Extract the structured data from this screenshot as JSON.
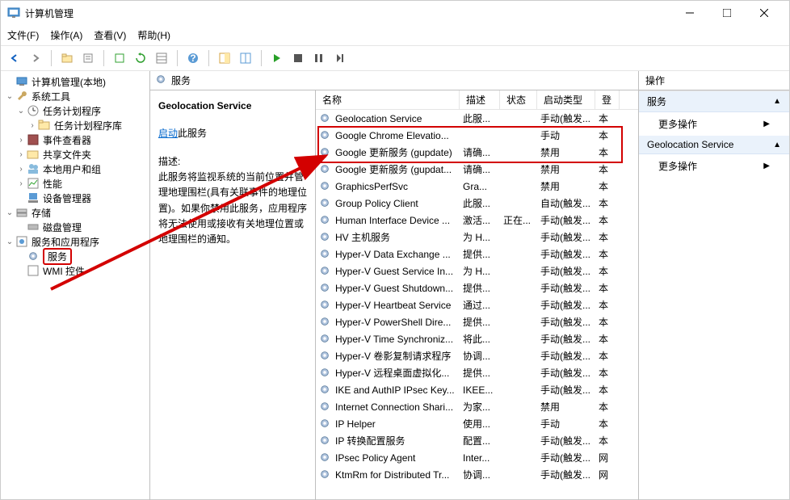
{
  "window": {
    "title": "计算机管理"
  },
  "menubar": [
    "文件(F)",
    "操作(A)",
    "查看(V)",
    "帮助(H)"
  ],
  "tree": {
    "root": "计算机管理(本地)",
    "system_tools": "系统工具",
    "task_scheduler": "任务计划程序",
    "task_lib": "任务计划程序库",
    "event_viewer": "事件查看器",
    "shared_folders": "共享文件夹",
    "local_users": "本地用户和组",
    "performance": "性能",
    "device_manager": "设备管理器",
    "storage": "存储",
    "disk_mgmt": "磁盘管理",
    "services_apps": "服务和应用程序",
    "services": "服务",
    "wmi": "WMI 控件"
  },
  "services_header": "服务",
  "detail": {
    "title": "Geolocation Service",
    "action_prefix_link": "启动",
    "action_suffix": "此服务",
    "desc_label": "描述:",
    "desc": "此服务将监视系统的当前位置并管理地理围栏(具有关联事件的地理位置)。如果你禁用此服务，应用程序将无法使用或接收有关地理位置或地理围栏的通知。"
  },
  "columns": {
    "name": "名称",
    "desc": "描述",
    "state": "状态",
    "start": "启动类型",
    "logon": "登"
  },
  "rows": [
    {
      "name": "Geolocation Service",
      "desc": "此服...",
      "state": "",
      "start": "手动(触发...",
      "log": "本"
    },
    {
      "name": "Google Chrome Elevatio...",
      "desc": "",
      "state": "",
      "start": "手动",
      "log": "本"
    },
    {
      "name": "Google 更新服务 (gupdate)",
      "desc": "请确...",
      "state": "",
      "start": "禁用",
      "log": "本"
    },
    {
      "name": "Google 更新服务 (gupdat...",
      "desc": "请确...",
      "state": "",
      "start": "禁用",
      "log": "本"
    },
    {
      "name": "GraphicsPerfSvc",
      "desc": "Gra...",
      "state": "",
      "start": "禁用",
      "log": "本"
    },
    {
      "name": "Group Policy Client",
      "desc": "此服...",
      "state": "",
      "start": "自动(触发...",
      "log": "本"
    },
    {
      "name": "Human Interface Device ...",
      "desc": "激活...",
      "state": "正在...",
      "start": "手动(触发...",
      "log": "本"
    },
    {
      "name": "HV 主机服务",
      "desc": "为 H...",
      "state": "",
      "start": "手动(触发...",
      "log": "本"
    },
    {
      "name": "Hyper-V Data Exchange ...",
      "desc": "提供...",
      "state": "",
      "start": "手动(触发...",
      "log": "本"
    },
    {
      "name": "Hyper-V Guest Service In...",
      "desc": "为 H...",
      "state": "",
      "start": "手动(触发...",
      "log": "本"
    },
    {
      "name": "Hyper-V Guest Shutdown...",
      "desc": "提供...",
      "state": "",
      "start": "手动(触发...",
      "log": "本"
    },
    {
      "name": "Hyper-V Heartbeat Service",
      "desc": "通过...",
      "state": "",
      "start": "手动(触发...",
      "log": "本"
    },
    {
      "name": "Hyper-V PowerShell Dire...",
      "desc": "提供...",
      "state": "",
      "start": "手动(触发...",
      "log": "本"
    },
    {
      "name": "Hyper-V Time Synchroniz...",
      "desc": "将此...",
      "state": "",
      "start": "手动(触发...",
      "log": "本"
    },
    {
      "name": "Hyper-V 卷影复制请求程序",
      "desc": "协调...",
      "state": "",
      "start": "手动(触发...",
      "log": "本"
    },
    {
      "name": "Hyper-V 远程桌面虚拟化...",
      "desc": "提供...",
      "state": "",
      "start": "手动(触发...",
      "log": "本"
    },
    {
      "name": "IKE and AuthIP IPsec Key...",
      "desc": "IKEE...",
      "state": "",
      "start": "手动(触发...",
      "log": "本"
    },
    {
      "name": "Internet Connection Shari...",
      "desc": "为家...",
      "state": "",
      "start": "禁用",
      "log": "本"
    },
    {
      "name": "IP Helper",
      "desc": "使用...",
      "state": "",
      "start": "手动",
      "log": "本"
    },
    {
      "name": "IP 转换配置服务",
      "desc": "配置...",
      "state": "",
      "start": "手动(触发...",
      "log": "本"
    },
    {
      "name": "IPsec Policy Agent",
      "desc": "Inter...",
      "state": "",
      "start": "手动(触发...",
      "log": "网"
    },
    {
      "name": "KtmRm for Distributed Tr...",
      "desc": "协调...",
      "state": "",
      "start": "手动(触发...",
      "log": "网"
    }
  ],
  "actions": {
    "header": "操作",
    "services_sec": "服务",
    "more_actions": "更多操作",
    "geo_sec": "Geolocation Service"
  }
}
